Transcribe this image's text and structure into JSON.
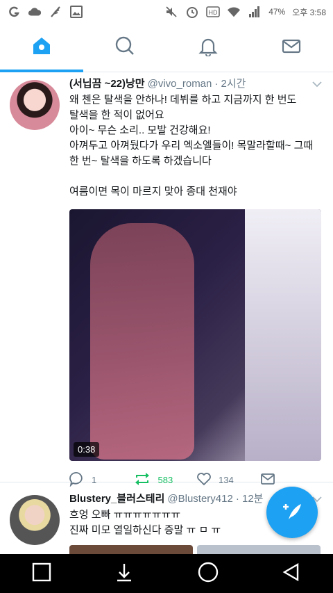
{
  "status_bar": {
    "battery": "47%",
    "time": "오후 3:58",
    "left_icons": [
      "g-app-icon",
      "cloud-icon",
      "feather-icon",
      "gallery-icon"
    ],
    "right_icons": [
      "mute-icon",
      "alarm-icon",
      "hd-icon",
      "wifi-icon",
      "signal-icon"
    ]
  },
  "tabs": [
    {
      "name": "home",
      "icon": "home-icon",
      "active": true
    },
    {
      "name": "search",
      "icon": "search-icon"
    },
    {
      "name": "notifications",
      "icon": "bell-icon"
    },
    {
      "name": "messages",
      "icon": "mail-icon"
    }
  ],
  "tweets": [
    {
      "display_name": "(서닙끔 ~22)낭만",
      "handle": "@vivo_roman",
      "time": "· 2시간",
      "text": "왜 첸은 탈색을 안하나! 데뷔를 하고 지금까지 한 번도\n탈색을 한 적이 없어요\n아이~ 무슨 소리.. 모발 건강해요!\n아껴두고 아껴뒀다가 우리 엑소엘들이! 목말라할때~ 그때\n한 번~ 탈색을 하도록 하겠습니다\n\n여름이면 목이 마르지 맞아 종대 천재야",
      "video_duration": "0:38",
      "replies": "1",
      "retweets": "583",
      "likes": "134"
    },
    {
      "display_name": "Blustery_블러스테리",
      "handle": "@Blustery412",
      "time": "· 12분",
      "text": "흐엉 오빠 ㅠㅠㅠㅠㅠㅠㅠ\n진짜 미모 열일하신다 증말 ㅠ ㅁ ㅠ"
    }
  ],
  "colors": {
    "accent": "#1da1f2",
    "retweet": "#17bf63",
    "muted": "#657786"
  }
}
